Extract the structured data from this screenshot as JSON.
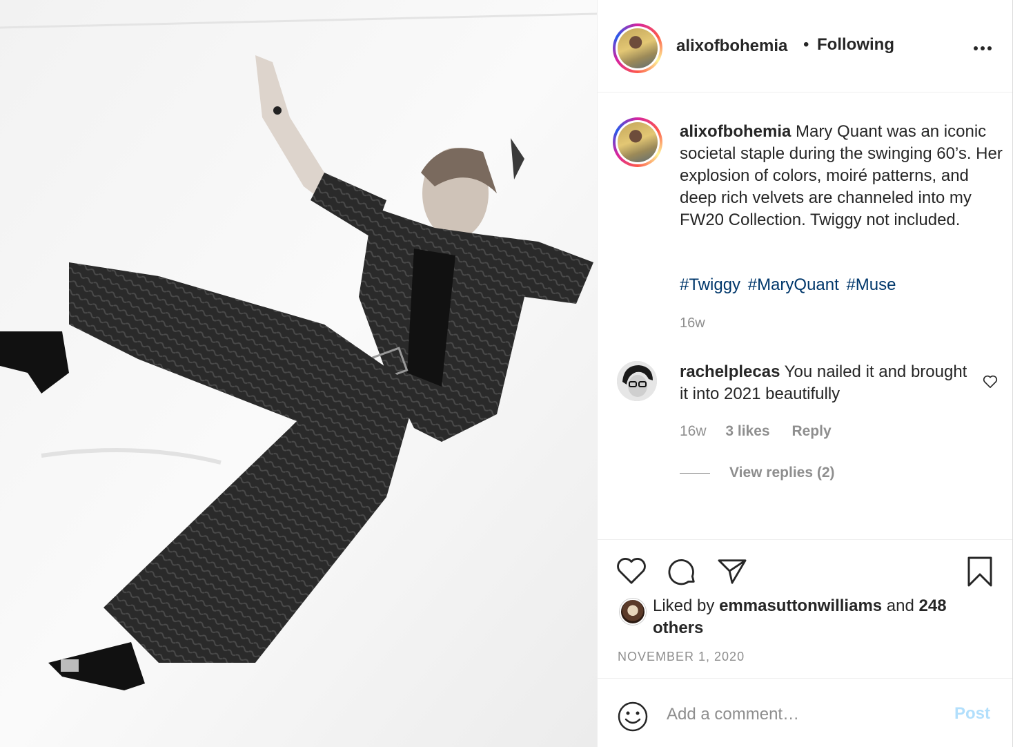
{
  "post": {
    "username": "alixofbohemia",
    "separator": "•",
    "follow_status": "Following",
    "more_icon": "more-options-icon"
  },
  "caption": {
    "username": "alixofbohemia",
    "text": "Mary Quant was an iconic societal staple during the swinging 60’s. Her explosion of colors, moiré patterns, and deep rich velvets are channeled into my FW20 Collection. Twiggy not included.",
    "hashtags": [
      "#Twiggy",
      "#MaryQuant",
      "#Muse"
    ],
    "time": "16w"
  },
  "comment": {
    "username": "rachelplecas",
    "text": "You nailed it and brought it into 2021 beautifully",
    "time": "16w",
    "likes": "3 likes",
    "reply_label": "Reply",
    "view_replies": "View replies (2)"
  },
  "likes": {
    "prefix": "Liked by",
    "liker": "emmasuttonwilliams",
    "connector": "and",
    "others": "248 others"
  },
  "date": "NOVEMBER 1, 2020",
  "add_comment": {
    "placeholder": "Add a comment…",
    "post_label": "Post"
  },
  "colors": {
    "link": "#00376b",
    "muted": "#8e8e8e",
    "post_disabled": "#b2dffc",
    "text": "#262626"
  }
}
